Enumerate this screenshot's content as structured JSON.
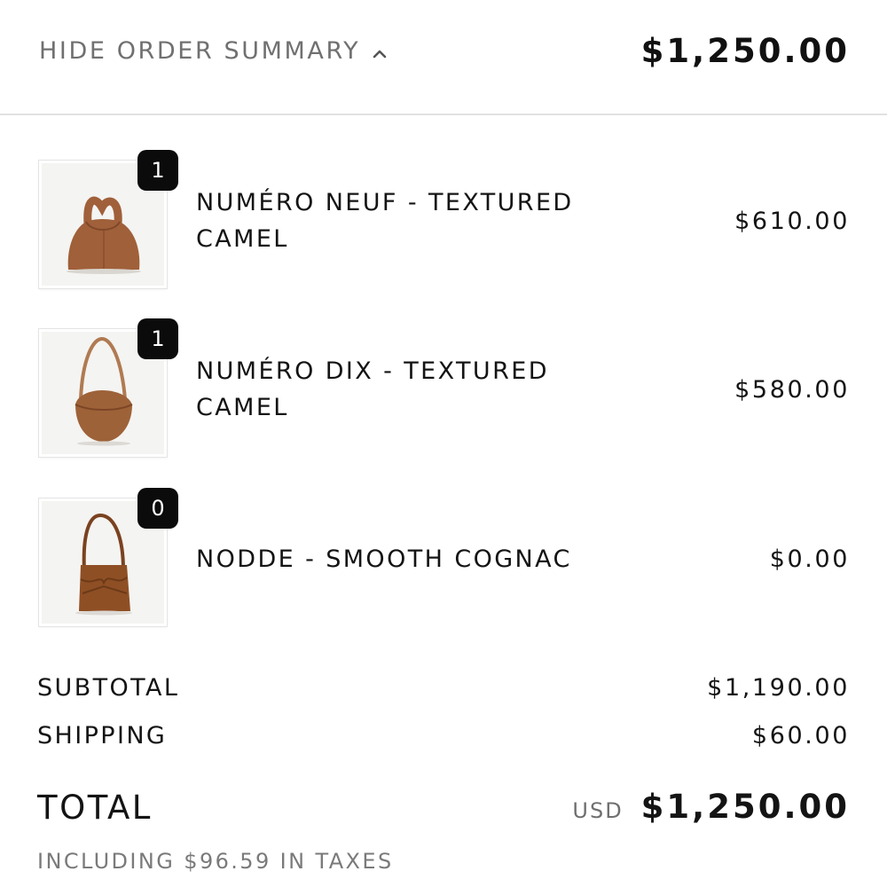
{
  "summary_header": {
    "toggle_label": "HIDE ORDER SUMMARY",
    "chevron_icon": "chevron-up-icon",
    "total": "$1,250.00"
  },
  "items": [
    {
      "name_line1": "NUMÉRO NEUF - TEXTURED",
      "name_line2": "CAMEL",
      "price": "$610.00",
      "quantity": "1",
      "image": "tote-bag-image",
      "color": "#a0603a"
    },
    {
      "name_line1": "NUMÉRO DIX - TEXTURED",
      "name_line2": "CAMEL",
      "price": "$580.00",
      "quantity": "1",
      "image": "half-moon-bag-image",
      "color": "#9e6238"
    },
    {
      "name_line1": "NODDE - SMOOTH COGNAC",
      "name_line2": "",
      "price": "$0.00",
      "quantity": "0",
      "image": "bucket-bag-image",
      "color": "#8f4f24"
    }
  ],
  "totals": {
    "subtotal_label": "SUBTOTAL",
    "subtotal_value": "$1,190.00",
    "shipping_label": "SHIPPING",
    "shipping_value": "$60.00",
    "total_label": "TOTAL",
    "currency": "USD",
    "total_value": "$1,250.00",
    "taxes_note": "INCLUDING $96.59 IN TAXES"
  }
}
